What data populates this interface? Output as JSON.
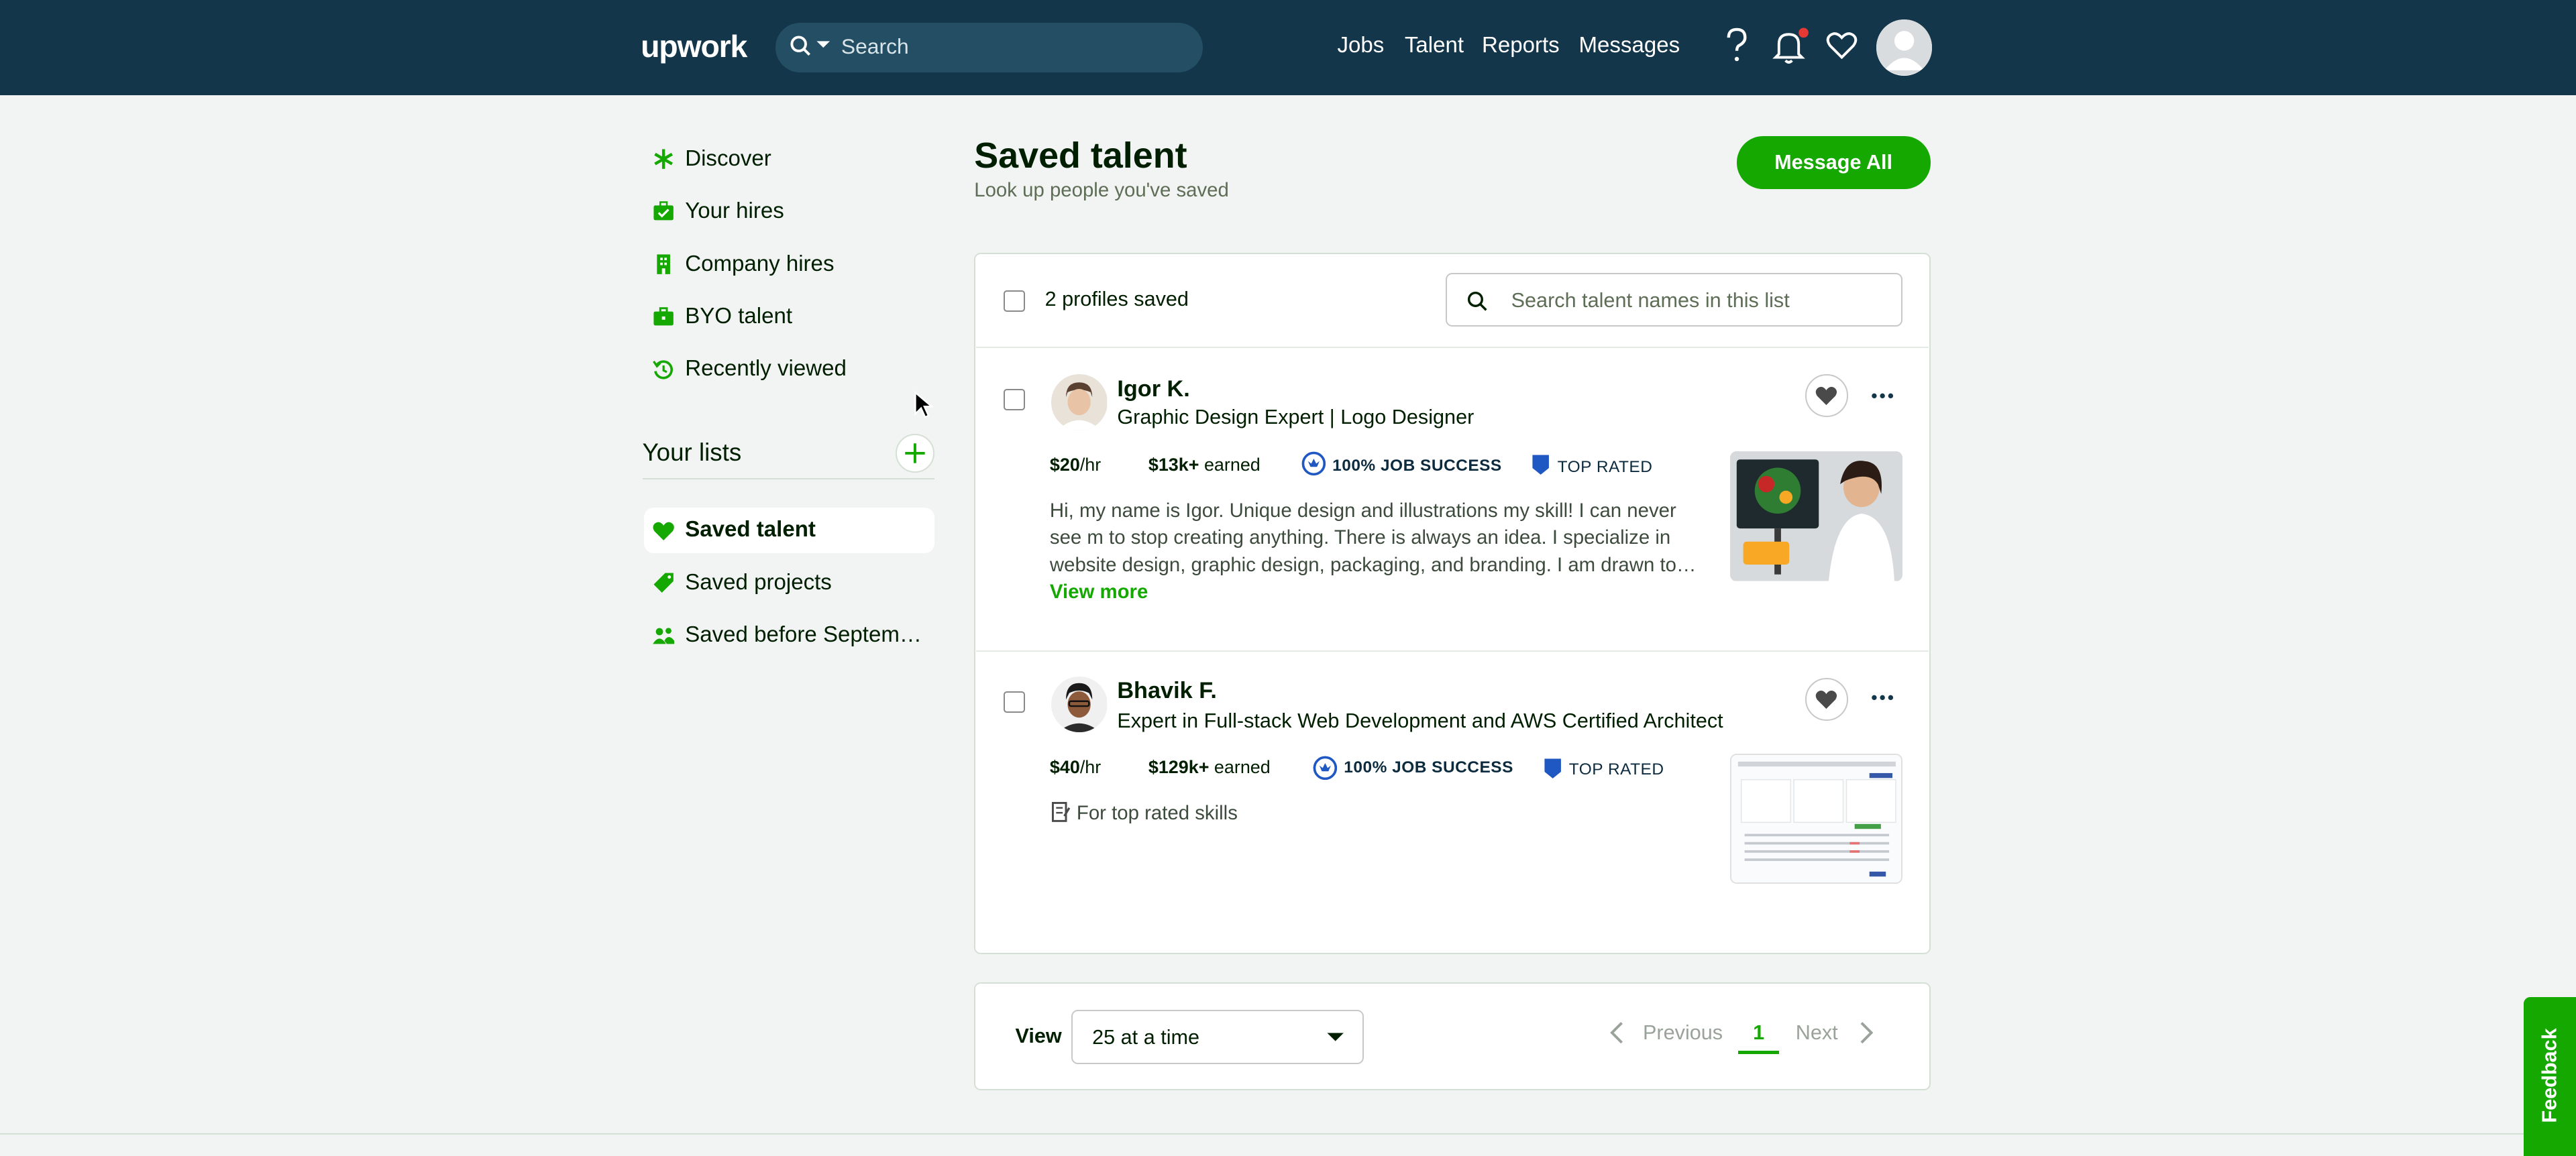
{
  "header": {
    "logo": "upwork",
    "search_placeholder": "Search",
    "nav": [
      "Jobs",
      "Talent",
      "Reports",
      "Messages"
    ],
    "icons": [
      "help-icon",
      "notification-bell-icon",
      "heart-icon",
      "avatar"
    ]
  },
  "sidebar": {
    "items": [
      {
        "label": "Discover",
        "icon": "asterisk-icon"
      },
      {
        "label": "Your hires",
        "icon": "briefcase-check-icon"
      },
      {
        "label": "Company hires",
        "icon": "building-icon"
      },
      {
        "label": "BYO talent",
        "icon": "briefcase-icon"
      },
      {
        "label": "Recently viewed",
        "icon": "history-icon"
      }
    ],
    "lists_heading": "Your lists",
    "lists": [
      {
        "label": "Saved talent",
        "icon": "heart-icon",
        "active": true
      },
      {
        "label": "Saved projects",
        "icon": "tag-icon"
      },
      {
        "label": "Saved before Septemb…",
        "icon": "people-icon"
      }
    ]
  },
  "main": {
    "title": "Saved talent",
    "subtitle": "Look up people you've saved",
    "message_all": "Message All",
    "count_label": "2 profiles saved",
    "list_search_placeholder": "Search talent names in this list",
    "talents": [
      {
        "name": "Igor K.",
        "title": "Graphic Design Expert | Logo Designer",
        "rate": "$20",
        "rate_unit": "/hr",
        "earned": "$13k+",
        "earned_label": " earned",
        "job_success": "100% JOB SUCCESS",
        "badge": "TOP RATED",
        "description": "Hi, my name is Igor. Unique design and illustrations my skill! I can never see m to stop creating anything. There is always an idea. I specialize in website design, graphic design, packaging, and branding. I am drawn to",
        "ellipsis": "…",
        "view_more": "View more"
      },
      {
        "name": "Bhavik F.",
        "title": "Expert in Full-stack Web Development and AWS Certified Architect",
        "rate": "$40",
        "rate_unit": "/hr",
        "earned": "$129k+",
        "earned_label": " earned",
        "job_success": "100% JOB SUCCESS",
        "badge": "TOP RATED",
        "skills_note": "For top rated skills"
      }
    ]
  },
  "pagination": {
    "view_label": "View",
    "per_page": "25 at a time",
    "previous": "Previous",
    "current": "1",
    "next": "Next"
  },
  "feedback": "Feedback",
  "colors": {
    "header_bg": "#13364a",
    "accent_green": "#14a800",
    "page_bg": "#f2f3f3"
  }
}
